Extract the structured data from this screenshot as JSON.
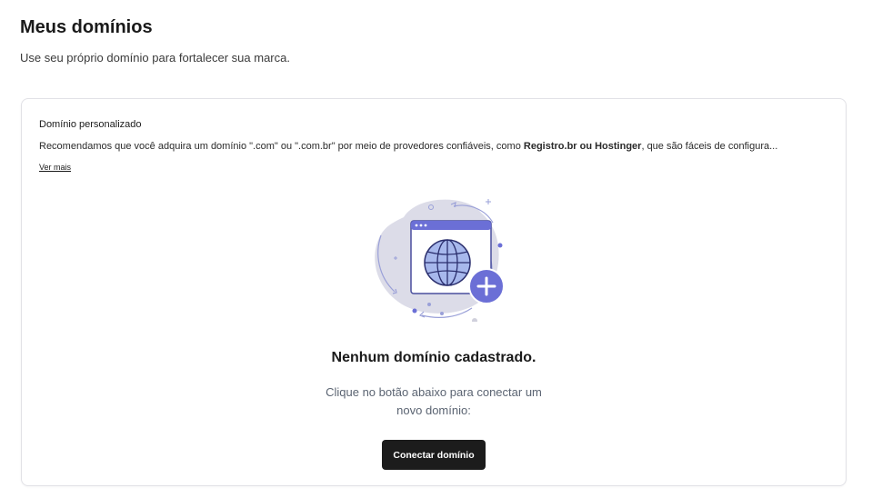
{
  "header": {
    "title": "Meus domínios",
    "subtitle": "Use seu próprio domínio para fortalecer sua marca."
  },
  "card": {
    "title": "Domínio personalizado",
    "description_prefix": "Recomendamos que você adquira um domínio \".com\" ou \".com.br\" por meio de provedores confiáveis, como ",
    "description_bold": "Registro.br ou Hostinger",
    "description_suffix": ", que são fáceis de configura...",
    "see_more_label": "Ver mais"
  },
  "empty_state": {
    "illustration_icon": "globe-browser-add-icon",
    "title": "Nenhum domínio cadastrado.",
    "description": "Clique no botão abaixo para conectar um novo domínio:",
    "button_label": "Conectar domínio"
  },
  "colors": {
    "accent": "#6b6fd6",
    "button_bg": "#1c1c1c",
    "illustration_bg": "#dcdce8"
  }
}
